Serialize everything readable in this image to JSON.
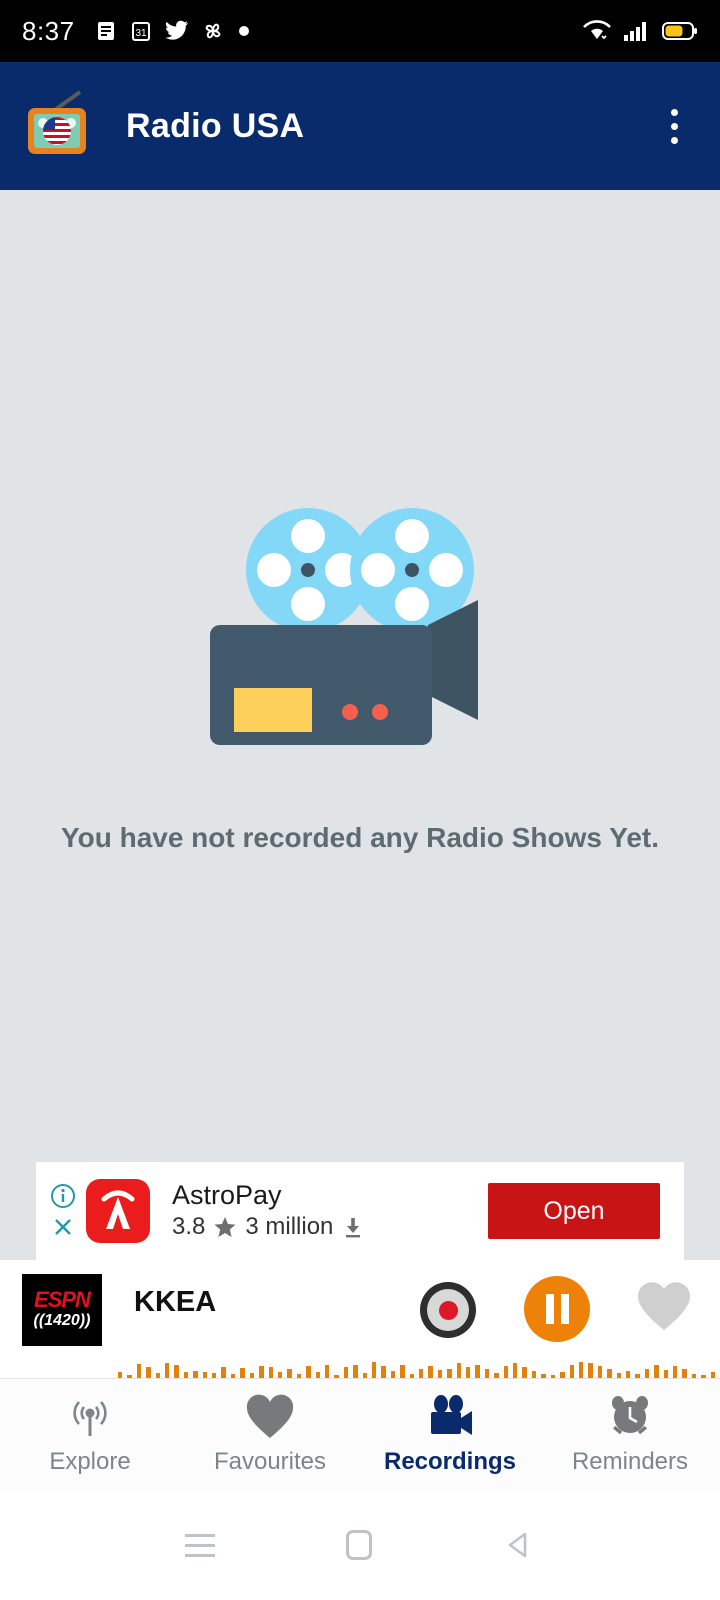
{
  "statusbar": {
    "time": "8:37",
    "left_icons": [
      "message-icon",
      "calendar-31-icon",
      "twitter-icon",
      "pinwheel-icon",
      "dot-icon"
    ],
    "calendar_day": "31",
    "right_icons": [
      "wifi-icon",
      "cellular-signal-icon",
      "battery-icon"
    ],
    "battery_color": "#F5C518"
  },
  "appbar": {
    "title": "Radio USA",
    "logo_icon": "radio-usa-logo",
    "overflow_icon": "three-dot-menu-icon",
    "background": "#0A2B6B"
  },
  "main": {
    "illustration_icon": "movie-camera-icon",
    "empty_message": "You have not recorded any Radio Shows Yet.",
    "background": "#E1E4E7"
  },
  "ad": {
    "info_icon": "ad-info-icon",
    "close_icon": "ad-close-icon",
    "app_icon": "astropay-app-icon",
    "title": "AstroPay",
    "rating": "3.8",
    "star_icon": "star-icon",
    "downloads": "3 million",
    "download_icon": "download-icon",
    "cta_label": "Open",
    "cta_color": "#C81414"
  },
  "player": {
    "station_logo_top": "ESPN",
    "station_logo_bottom": "((1420))",
    "station_name": "KKEA",
    "record_icon": "record-button-icon",
    "pause_icon": "pause-button-icon",
    "favourite_icon": "heart-icon",
    "accent_color": "#EE8208",
    "waveform_heights": [
      6,
      3,
      14,
      11,
      5,
      15,
      13,
      6,
      7,
      6,
      5,
      11,
      4,
      10,
      5,
      12,
      11,
      6,
      9,
      4,
      12,
      6,
      13,
      3,
      11,
      13,
      5,
      16,
      12,
      7,
      13,
      4,
      9,
      12,
      8,
      9,
      15,
      11,
      13,
      9,
      5,
      12,
      15,
      11,
      7,
      4,
      3,
      6,
      13,
      16,
      15,
      12,
      9,
      5,
      7,
      4,
      9,
      13,
      8,
      12,
      9,
      4,
      3,
      6
    ]
  },
  "tabs": [
    {
      "label": "Explore",
      "icon": "broadcast-icon",
      "active": false
    },
    {
      "label": "Favourites",
      "icon": "heart-icon",
      "active": false
    },
    {
      "label": "Recordings",
      "icon": "video-camera-icon",
      "active": true
    },
    {
      "label": "Reminders",
      "icon": "alarm-clock-icon",
      "active": false
    }
  ],
  "sysnav": {
    "recents_icon": "recents-icon",
    "home_icon": "home-icon",
    "back_icon": "back-icon"
  }
}
